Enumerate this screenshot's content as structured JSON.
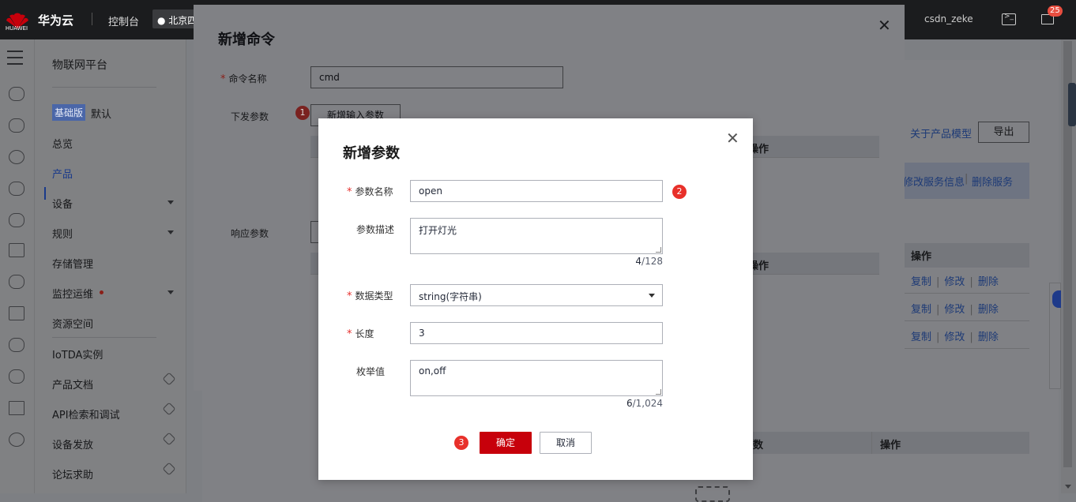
{
  "topbar": {
    "logo_text": "HUAWEI",
    "brand": "华为云",
    "console": "控制台",
    "region": "北京四",
    "user": "csdn_zeke",
    "mail_count": "25"
  },
  "sidebar": {
    "title": "物联网平台",
    "edition_badge": "基础版",
    "edition_default": "默认",
    "items": [
      {
        "label": "总览"
      },
      {
        "label": "产品"
      },
      {
        "label": "设备"
      },
      {
        "label": "规则"
      },
      {
        "label": "存储管理"
      },
      {
        "label": "监控运维"
      },
      {
        "label": "资源空间"
      },
      {
        "label": "IoTDA实例"
      },
      {
        "label": "产品文档"
      },
      {
        "label": "API检索和调试"
      },
      {
        "label": "设备发放"
      },
      {
        "label": "论坛求助"
      }
    ]
  },
  "background": {
    "about_model_link": "关于产品模型",
    "export_button": "导出",
    "modify_service": "修改服务信息",
    "delete_service": "删除服务",
    "col_operation": "操作",
    "col_partial_tail": "数",
    "row_actions": [
      {
        "copy": "复制",
        "modify": "修改",
        "delete": "删除"
      },
      {
        "copy": "复制",
        "modify": "修改",
        "delete": "删除"
      },
      {
        "copy": "复制",
        "modify": "修改",
        "delete": "删除"
      }
    ]
  },
  "dialog_command": {
    "title": "新增命令",
    "name_label": "命令名称",
    "name_value": "cmd",
    "down_params_label": "下发参数",
    "add_input_param_button": "新增输入参数",
    "response_params_label": "响应参数",
    "table_operation_header": "操作",
    "table_operation_header_2": "操作",
    "step_1": "1"
  },
  "dialog_param": {
    "title": "新增参数",
    "param_name_label": "参数名称",
    "param_name_value": "open",
    "param_desc_label": "参数描述",
    "param_desc_value": "打开灯光",
    "desc_count": "4",
    "desc_max": "/128",
    "data_type_label": "数据类型",
    "data_type_value": "string(字符串)",
    "length_label": "长度",
    "length_value": "3",
    "enum_label": "枚举值",
    "enum_value": "on,off",
    "enum_count": "6",
    "enum_max": "/1,024",
    "confirm_button": "确定",
    "cancel_button": "取消",
    "step_2": "2",
    "step_3": "3"
  }
}
